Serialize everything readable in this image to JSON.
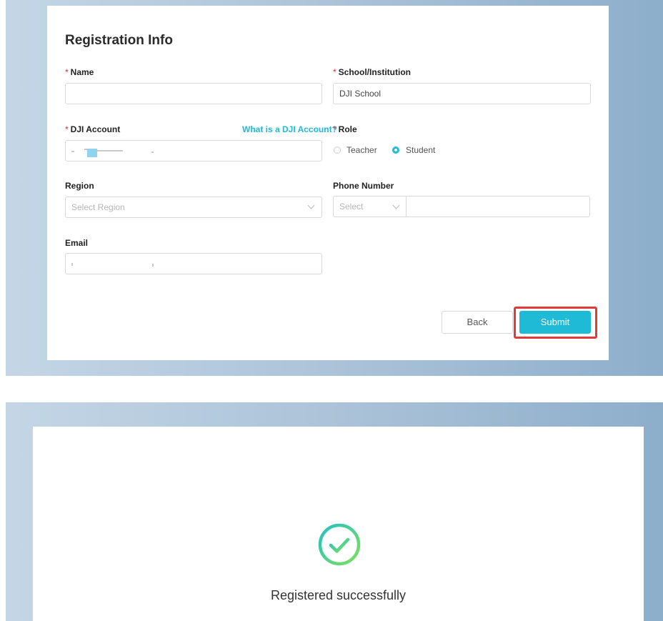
{
  "form": {
    "title": "Registration Info",
    "required_mark": "*",
    "name": {
      "label": "Name",
      "value": ""
    },
    "school": {
      "label": "School/Institution",
      "value": "DJI School"
    },
    "dji_account": {
      "label": "DJI Account",
      "help_link": "What is a DJI Account?",
      "value": ""
    },
    "role": {
      "label": "Role",
      "options": [
        "Teacher",
        "Student"
      ],
      "selected": "Student"
    },
    "region": {
      "label": "Region",
      "placeholder": "Select Region"
    },
    "phone": {
      "label": "Phone Number",
      "code_placeholder": "Select",
      "value": ""
    },
    "email": {
      "label": "Email",
      "value": ""
    },
    "buttons": {
      "back": "Back",
      "submit": "Submit"
    }
  },
  "success": {
    "message": "Registered successfully",
    "icon": "check-circle-icon"
  },
  "colors": {
    "accent": "#1fbad6",
    "required": "#f5222d",
    "highlight": "#e5383b",
    "success_gradient_start": "#22c1c3",
    "success_gradient_end": "#7be15a"
  }
}
